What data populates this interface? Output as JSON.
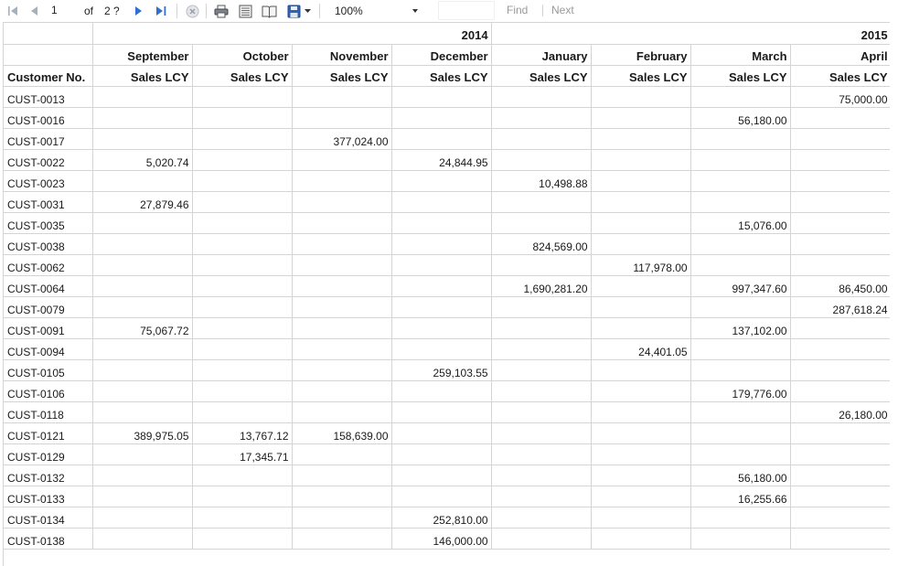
{
  "toolbar": {
    "page_current": "1",
    "page_of_label": "of",
    "page_total": "2 ?",
    "zoom_value": "100%",
    "find_label": "Find",
    "next_label": "Next"
  },
  "report": {
    "years": {
      "y2014": "2014",
      "y2015": "2015"
    },
    "customer_header": "Customer No.",
    "months": [
      "September",
      "October",
      "November",
      "December",
      "January",
      "February",
      "March",
      "April"
    ],
    "measure_label": "Sales LCY",
    "rows": [
      {
        "customer": "CUST-0013",
        "values": [
          "",
          "",
          "",
          "",
          "",
          "",
          "",
          "75,000.00"
        ]
      },
      {
        "customer": "CUST-0016",
        "values": [
          "",
          "",
          "",
          "",
          "",
          "",
          "56,180.00",
          ""
        ]
      },
      {
        "customer": "CUST-0017",
        "values": [
          "",
          "",
          "377,024.00",
          "",
          "",
          "",
          "",
          ""
        ]
      },
      {
        "customer": "CUST-0022",
        "values": [
          "5,020.74",
          "",
          "",
          "24,844.95",
          "",
          "",
          "",
          ""
        ]
      },
      {
        "customer": "CUST-0023",
        "values": [
          "",
          "",
          "",
          "",
          "10,498.88",
          "",
          "",
          ""
        ]
      },
      {
        "customer": "CUST-0031",
        "values": [
          "27,879.46",
          "",
          "",
          "",
          "",
          "",
          "",
          ""
        ]
      },
      {
        "customer": "CUST-0035",
        "values": [
          "",
          "",
          "",
          "",
          "",
          "",
          "15,076.00",
          ""
        ]
      },
      {
        "customer": "CUST-0038",
        "values": [
          "",
          "",
          "",
          "",
          "824,569.00",
          "",
          "",
          ""
        ]
      },
      {
        "customer": "CUST-0062",
        "values": [
          "",
          "",
          "",
          "",
          "",
          "117,978.00",
          "",
          ""
        ]
      },
      {
        "customer": "CUST-0064",
        "values": [
          "",
          "",
          "",
          "",
          "1,690,281.20",
          "",
          "997,347.60",
          "86,450.00"
        ]
      },
      {
        "customer": "CUST-0079",
        "values": [
          "",
          "",
          "",
          "",
          "",
          "",
          "",
          "287,618.24"
        ]
      },
      {
        "customer": "CUST-0091",
        "values": [
          "75,067.72",
          "",
          "",
          "",
          "",
          "",
          "137,102.00",
          ""
        ]
      },
      {
        "customer": "CUST-0094",
        "values": [
          "",
          "",
          "",
          "",
          "",
          "24,401.05",
          "",
          ""
        ]
      },
      {
        "customer": "CUST-0105",
        "values": [
          "",
          "",
          "",
          "259,103.55",
          "",
          "",
          "",
          ""
        ]
      },
      {
        "customer": "CUST-0106",
        "values": [
          "",
          "",
          "",
          "",
          "",
          "",
          "179,776.00",
          ""
        ]
      },
      {
        "customer": "CUST-0118",
        "values": [
          "",
          "",
          "",
          "",
          "",
          "",
          "",
          "26,180.00"
        ]
      },
      {
        "customer": "CUST-0121",
        "values": [
          "389,975.05",
          "13,767.12",
          "158,639.00",
          "",
          "",
          "",
          "",
          ""
        ]
      },
      {
        "customer": "CUST-0129",
        "values": [
          "",
          "17,345.71",
          "",
          "",
          "",
          "",
          "",
          ""
        ]
      },
      {
        "customer": "CUST-0132",
        "values": [
          "",
          "",
          "",
          "",
          "",
          "",
          "56,180.00",
          ""
        ]
      },
      {
        "customer": "CUST-0133",
        "values": [
          "",
          "",
          "",
          "",
          "",
          "",
          "16,255.66",
          ""
        ]
      },
      {
        "customer": "CUST-0134",
        "values": [
          "",
          "",
          "",
          "252,810.00",
          "",
          "",
          "",
          ""
        ]
      },
      {
        "customer": "CUST-0138",
        "values": [
          "",
          "",
          "",
          "146,000.00",
          "",
          "",
          "",
          ""
        ]
      }
    ]
  }
}
